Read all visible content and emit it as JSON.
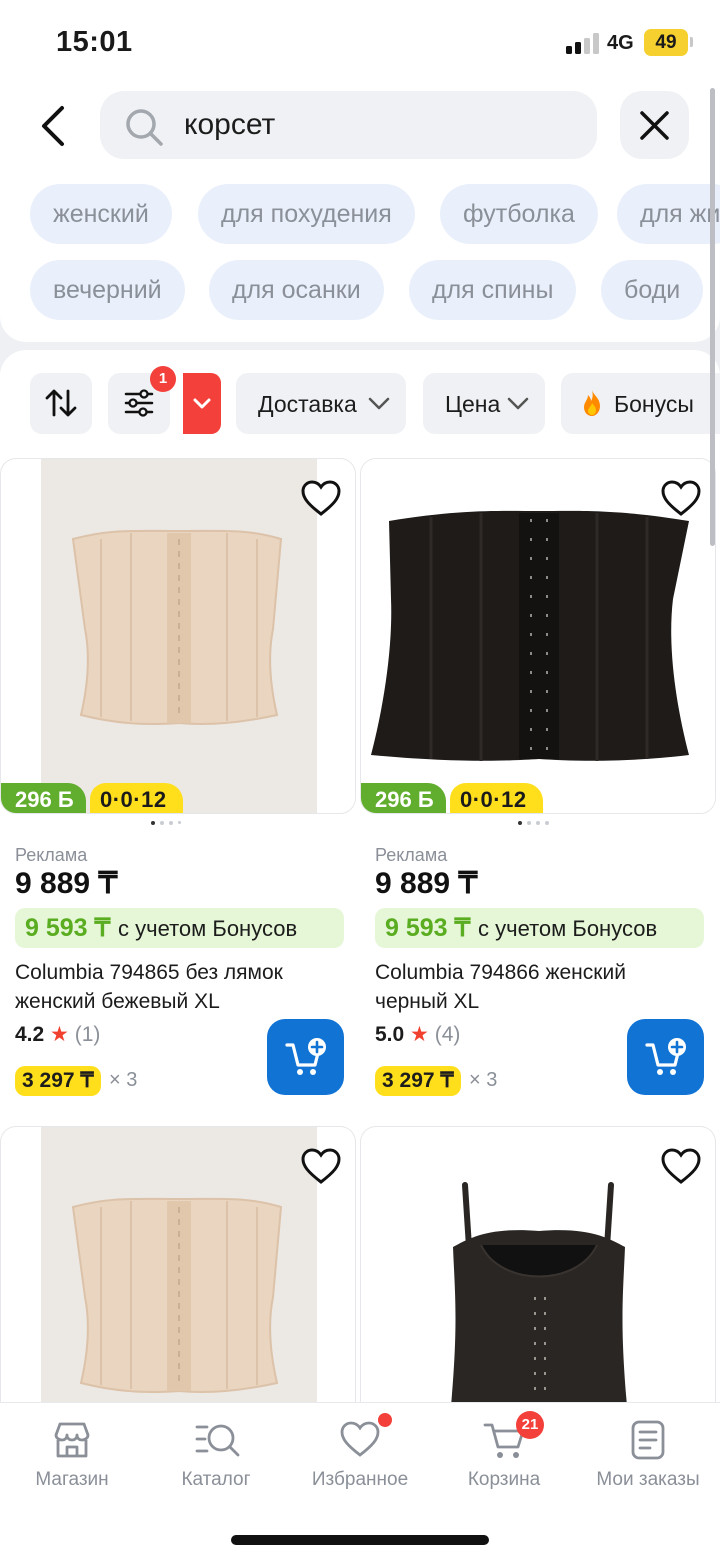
{
  "status_bar": {
    "time": "15:01",
    "network": "4G",
    "battery": "49"
  },
  "search": {
    "query": "корсет"
  },
  "suggestions": [
    [
      "женский",
      "для похудения",
      "футболка",
      "для жи"
    ],
    [
      "вечерний",
      "для осанки",
      "для спины",
      "боди"
    ]
  ],
  "filters": {
    "active_count": "1",
    "delivery_label": "Доставка",
    "price_label": "Цена",
    "bonus_label": "Бонусы"
  },
  "products": [
    {
      "ad_label": "Реклама",
      "price": "9 889 ₸",
      "bonus_amount": "9 593 ₸",
      "bonus_text": "с учетом Бонусов",
      "title": "Columbia 794865 без лямок женский бежевый XL",
      "rating": "4.2",
      "reviews": "(1)",
      "installment": "3 297 ₸",
      "installment_multiplier": "× 3",
      "bonus_tag": "296 Б",
      "installment_tag": "0·0·12",
      "color": "#ead5c0"
    },
    {
      "ad_label": "Реклама",
      "price": "9 889 ₸",
      "bonus_amount": "9 593 ₸",
      "bonus_text": "с учетом Бонусов",
      "title": "Columbia 794866 женский черный XL",
      "rating": "5.0",
      "reviews": "(4)",
      "installment": "3 297 ₸",
      "installment_multiplier": "× 3",
      "bonus_tag": "296 Б",
      "installment_tag": "0·0·12",
      "color": "#1e1b19"
    }
  ],
  "bottom_nav": [
    {
      "label": "Магазин",
      "icon": "store-icon"
    },
    {
      "label": "Каталог",
      "icon": "catalog-icon"
    },
    {
      "label": "Избранное",
      "icon": "heart-icon"
    },
    {
      "label": "Корзина",
      "icon": "cart-icon",
      "badge": "21"
    },
    {
      "label": "Мои заказы",
      "icon": "orders-icon"
    }
  ]
}
